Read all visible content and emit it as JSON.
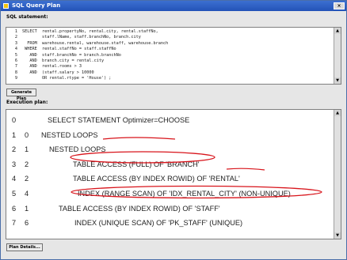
{
  "window": {
    "title": "SQL Query Plan",
    "title_buttons": "×"
  },
  "sql_section": {
    "label": "SQL statement:",
    "lines": [
      {
        "num": "1",
        "code": "SELECT  rental.propertyNo, rental.city, rental.staffNo,"
      },
      {
        "num": "2",
        "code": "        staff.lName, staff.branchNo, branch.city"
      },
      {
        "num": "3",
        "code": "  FROM  warehouse.rental, warehouse.staff, warehouse.branch"
      },
      {
        "num": "4",
        "code": " WHERE  rental.staffNo = staff.staffNo"
      },
      {
        "num": "5",
        "code": "   AND  staff.branchNo = branch.branchNo"
      },
      {
        "num": "6",
        "code": "   AND  branch.city = rental.city"
      },
      {
        "num": "7",
        "code": "   AND  rental.rooms > 3"
      },
      {
        "num": "8",
        "code": "   AND  (staff.salary > 10000"
      },
      {
        "num": "9",
        "code": "        OR rental.rtype = 'House') ;"
      }
    ],
    "generate_button": "Generate Plan"
  },
  "plan_section": {
    "label": "Execution plan:",
    "rows": [
      {
        "id": "0",
        "parent": "",
        "operation": "SELECT STATEMENT Optimizer=CHOOSE"
      },
      {
        "id": "1",
        "parent": "0",
        "operation": "NESTED LOOPS"
      },
      {
        "id": "2",
        "parent": "1",
        "operation": "NESTED LOOPS"
      },
      {
        "id": "3",
        "parent": "2",
        "operation": "TABLE ACCESS (FULL) OF 'BRANCH'"
      },
      {
        "id": "4",
        "parent": "2",
        "operation": "TABLE ACCESS (BY INDEX ROWID) OF 'RENTAL'"
      },
      {
        "id": "5",
        "parent": "4",
        "operation": "INDEX (RANGE SCAN) OF 'IDX_RENTAL_CITY' (NON-UNIQUE)"
      },
      {
        "id": "6",
        "parent": "1",
        "operation": "TABLE ACCESS (BY INDEX ROWID) OF 'STAFF'"
      },
      {
        "id": "7",
        "parent": "6",
        "operation": "INDEX (UNIQUE SCAN) OF 'PK_STAFF' (UNIQUE)"
      }
    ],
    "details_button": "Plan Details..."
  },
  "colors": {
    "annotation": "#d8141b",
    "titlebar": "#2a5bc2"
  }
}
